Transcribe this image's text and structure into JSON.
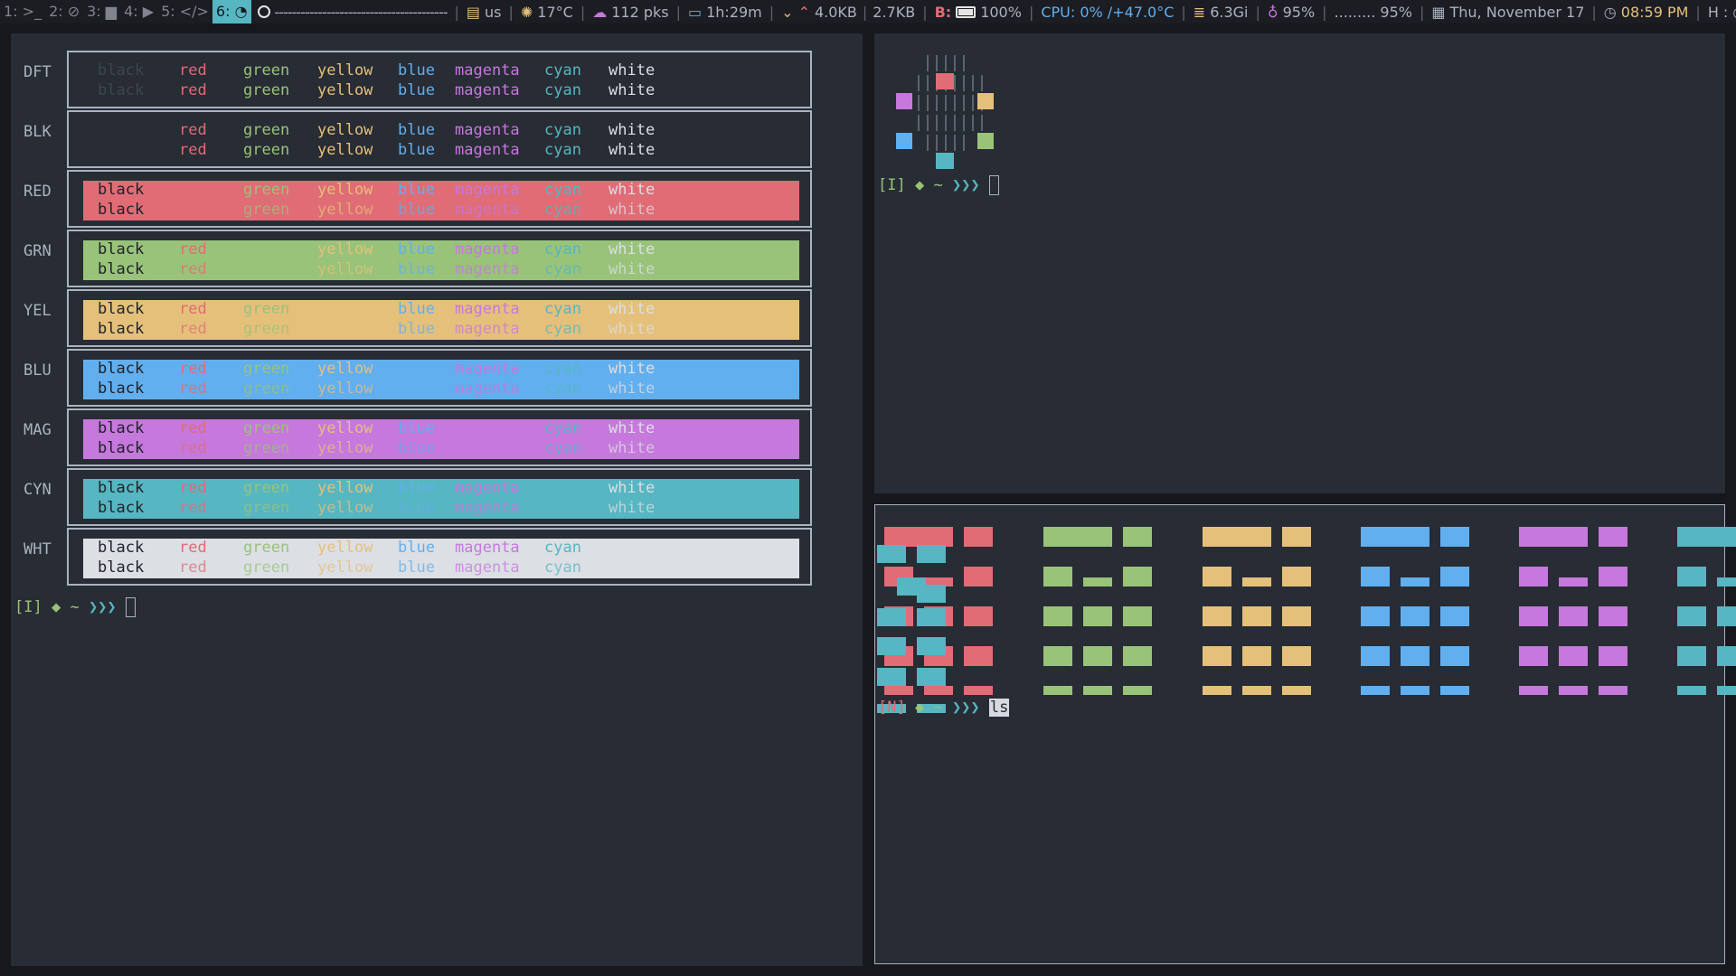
{
  "topbar": {
    "workspaces": [
      {
        "label": "1: >_",
        "active": false
      },
      {
        "label": "2: ⊘",
        "active": false
      },
      {
        "label": "3: ▆",
        "active": false
      },
      {
        "label": "4: ▶",
        "active": false
      },
      {
        "label": "5: </>",
        "active": false
      },
      {
        "label": "6: ◔",
        "active": true
      }
    ],
    "media_dashes": "----------------------------------------",
    "keyboard": "us",
    "weather": "17°C",
    "packages": "112 pks",
    "uptime": "1h:29m",
    "net_down": "4.0KB",
    "net_up": "2.7KB",
    "battery_label": "B:",
    "battery": "100%",
    "cpu": "CPU: 0% /+47.0°C",
    "memory": "6.3Gi",
    "brightness": "95%",
    "volume": "......... 95%",
    "date": "Thu, November 17",
    "time": "08:59 PM",
    "host_label": "H :"
  },
  "colors": {
    "black": "#1e2127",
    "red": "#e06c75",
    "green": "#98c379",
    "yellow": "#e5c07b",
    "blue": "#61afef",
    "magenta": "#c678dd",
    "cyan": "#56b6c2",
    "white": "#dcdfe4",
    "dim_black": "#3e4452",
    "bg": "#282c34"
  },
  "color_table": {
    "rows": [
      {
        "label": "DFT",
        "bg": null
      },
      {
        "label": "BLK",
        "bg": "black"
      },
      {
        "label": "RED",
        "bg": "red"
      },
      {
        "label": "GRN",
        "bg": "green"
      },
      {
        "label": "YEL",
        "bg": "yellow"
      },
      {
        "label": "BLU",
        "bg": "blue"
      },
      {
        "label": "MAG",
        "bg": "magenta"
      },
      {
        "label": "CYN",
        "bg": "cyan"
      },
      {
        "label": "WHT",
        "bg": "white"
      }
    ],
    "columns": [
      "black",
      "red",
      "green",
      "yellow",
      "blue",
      "magenta",
      "cyan",
      "white"
    ]
  },
  "prompts": {
    "left": {
      "mode": "[I]",
      "path": "◆ ~",
      "arrows": "❯❯❯",
      "input": ""
    },
    "top_right": {
      "mode": "[I]",
      "path": "◆ ~",
      "arrows": "❯❯❯",
      "input": ""
    },
    "bottom_right": {
      "mode": "[N]",
      "path": "◆ ~",
      "arrows": "❯❯❯",
      "input": "ls"
    }
  }
}
